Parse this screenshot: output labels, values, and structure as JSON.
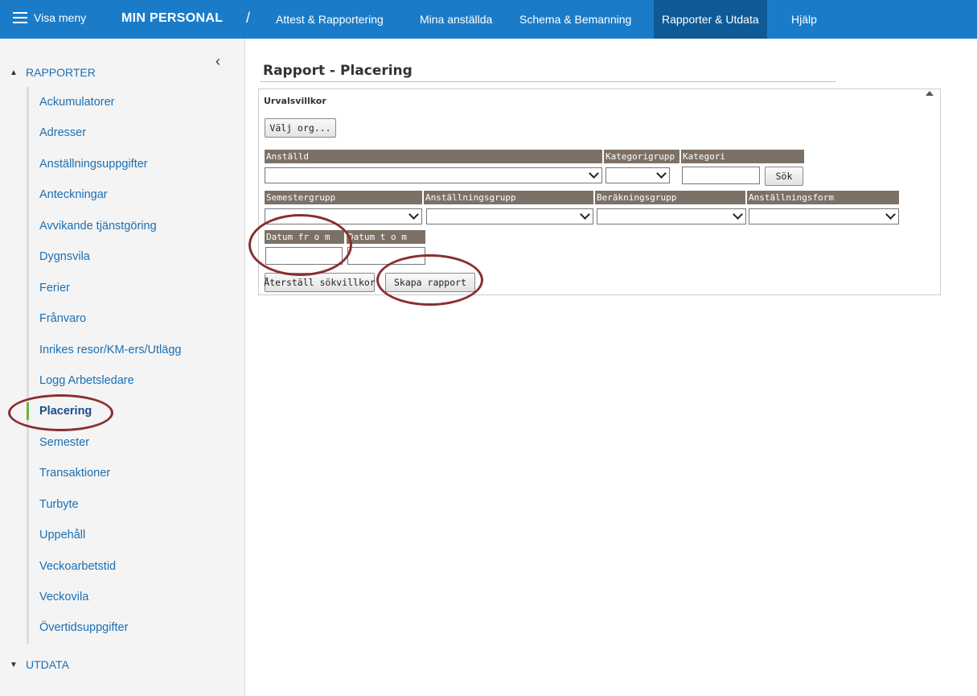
{
  "topbar": {
    "menu_label": "Visa meny",
    "brand": "MIN PERSONAL",
    "separator": "/",
    "nav": [
      {
        "label": "Attest & Rapportering"
      },
      {
        "label": "Mina anställda"
      },
      {
        "label": "Schema & Bemanning"
      },
      {
        "label": "Rapporter & Utdata"
      },
      {
        "label": "Hjälp"
      }
    ]
  },
  "sidebar": {
    "collapse_glyph": "‹",
    "section_rapporter": "RAPPORTER",
    "section_utdata": "UTDATA",
    "items": [
      {
        "label": "Ackumulatorer"
      },
      {
        "label": "Adresser"
      },
      {
        "label": "Anställningsuppgifter"
      },
      {
        "label": "Anteckningar"
      },
      {
        "label": "Avvikande tjänstgöring"
      },
      {
        "label": "Dygnsvila"
      },
      {
        "label": "Ferier"
      },
      {
        "label": "Frånvaro"
      },
      {
        "label": "Inrikes resor/KM-ers/Utlägg"
      },
      {
        "label": "Logg Arbetsledare"
      },
      {
        "label": "Placering"
      },
      {
        "label": "Semester"
      },
      {
        "label": "Transaktioner"
      },
      {
        "label": "Turbyte"
      },
      {
        "label": "Uppehåll"
      },
      {
        "label": "Veckoarbetstid"
      },
      {
        "label": "Veckovila"
      },
      {
        "label": "Övertidsuppgifter"
      }
    ]
  },
  "main": {
    "title": "Rapport - Placering",
    "panel_heading": "Urvalsvillkor",
    "valj_org_label": "Välj org...",
    "fields": {
      "anstalld": "Anställd",
      "kategorigrupp": "Kategorigrupp",
      "kategori": "Kategori",
      "sok_label": "Sök",
      "semestergrupp": "Semestergrupp",
      "anstallningsgrupp": "Anställningsgrupp",
      "berakningsgrupp": "Beräkningsgrupp",
      "anstallningsform": "Anställningsform",
      "datum_from": "Datum fr o m",
      "datum_tom": "Datum t o m"
    },
    "values": {
      "anstalld": "",
      "kategorigrupp": "",
      "kategori": "",
      "semestergrupp": "",
      "anstallningsgrupp": "",
      "berakningsgrupp": "",
      "anstallningsform": "",
      "datum_from": "",
      "datum_tom": ""
    },
    "reset_label": "Återställ sökvillkor",
    "create_label": "Skapa rapport"
  },
  "colors": {
    "topbar": "#1a7cc9",
    "topbar_active": "#0d5a97",
    "label_bg": "#7c7167",
    "annotation": "#8b2f2f",
    "active_marker": "#6db33f"
  }
}
